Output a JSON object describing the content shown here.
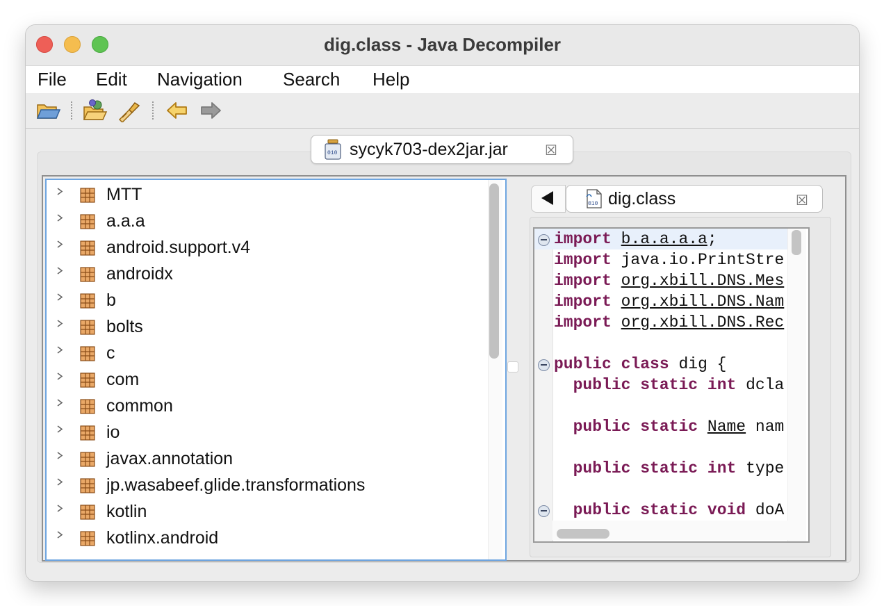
{
  "window": {
    "title": "dig.class - Java Decompiler"
  },
  "menu": [
    "File",
    "Edit",
    "Navigation",
    "Search",
    "Help"
  ],
  "toolbar": {
    "buttons": [
      {
        "name": "open-file-icon"
      },
      {
        "name": "open-type-icon"
      },
      {
        "name": "search-icon"
      },
      {
        "name": "back-arrow-icon"
      },
      {
        "name": "forward-arrow-icon"
      }
    ]
  },
  "jar_tab": {
    "label": "sycyk703-dex2jar.jar",
    "icon": "jar-file-icon"
  },
  "tree": {
    "items": [
      "MTT",
      "a.a.a",
      "android.support.v4",
      "androidx",
      "b",
      "bolts",
      "c",
      "com",
      "common",
      "io",
      "javax.annotation",
      "jp.wasabeef.glide.transformations",
      "kotlin",
      "kotlinx.android"
    ]
  },
  "class_tab": {
    "label": "dig.class",
    "icon": "class-file-icon"
  },
  "code": {
    "lines": [
      [
        {
          "t": "import",
          "k": "kw"
        },
        {
          "t": " "
        },
        {
          "t": "b.a.a.a.a",
          "k": "lnk"
        },
        {
          "t": ";"
        }
      ],
      [
        {
          "t": "import",
          "k": "kw"
        },
        {
          "t": " java.io.PrintStre"
        }
      ],
      [
        {
          "t": "import",
          "k": "kw"
        },
        {
          "t": " "
        },
        {
          "t": "org.xbill.DNS.Mes",
          "k": "lnk"
        }
      ],
      [
        {
          "t": "import",
          "k": "kw"
        },
        {
          "t": " "
        },
        {
          "t": "org.xbill.DNS.Nam",
          "k": "lnk"
        }
      ],
      [
        {
          "t": "import",
          "k": "kw"
        },
        {
          "t": " "
        },
        {
          "t": "org.xbill.DNS.Rec",
          "k": "lnk"
        }
      ],
      [],
      [
        {
          "t": "public",
          "k": "kw"
        },
        {
          "t": " "
        },
        {
          "t": "class",
          "k": "kw"
        },
        {
          "t": " dig {"
        }
      ],
      [
        {
          "t": "  "
        },
        {
          "t": "public",
          "k": "kw"
        },
        {
          "t": " "
        },
        {
          "t": "static",
          "k": "kw"
        },
        {
          "t": " "
        },
        {
          "t": "int",
          "k": "kw"
        },
        {
          "t": " dcla"
        }
      ],
      [],
      [
        {
          "t": "  "
        },
        {
          "t": "public",
          "k": "kw"
        },
        {
          "t": " "
        },
        {
          "t": "static",
          "k": "kw"
        },
        {
          "t": " "
        },
        {
          "t": "Name",
          "k": "lnk"
        },
        {
          "t": " nam"
        }
      ],
      [],
      [
        {
          "t": "  "
        },
        {
          "t": "public",
          "k": "kw"
        },
        {
          "t": " "
        },
        {
          "t": "static",
          "k": "kw"
        },
        {
          "t": " "
        },
        {
          "t": "int",
          "k": "kw"
        },
        {
          "t": " type"
        }
      ],
      [],
      [
        {
          "t": "  "
        },
        {
          "t": "public",
          "k": "kw"
        },
        {
          "t": " "
        },
        {
          "t": "static",
          "k": "kw"
        },
        {
          "t": " "
        },
        {
          "t": "void",
          "k": "kw"
        },
        {
          "t": " doA"
        }
      ]
    ]
  }
}
